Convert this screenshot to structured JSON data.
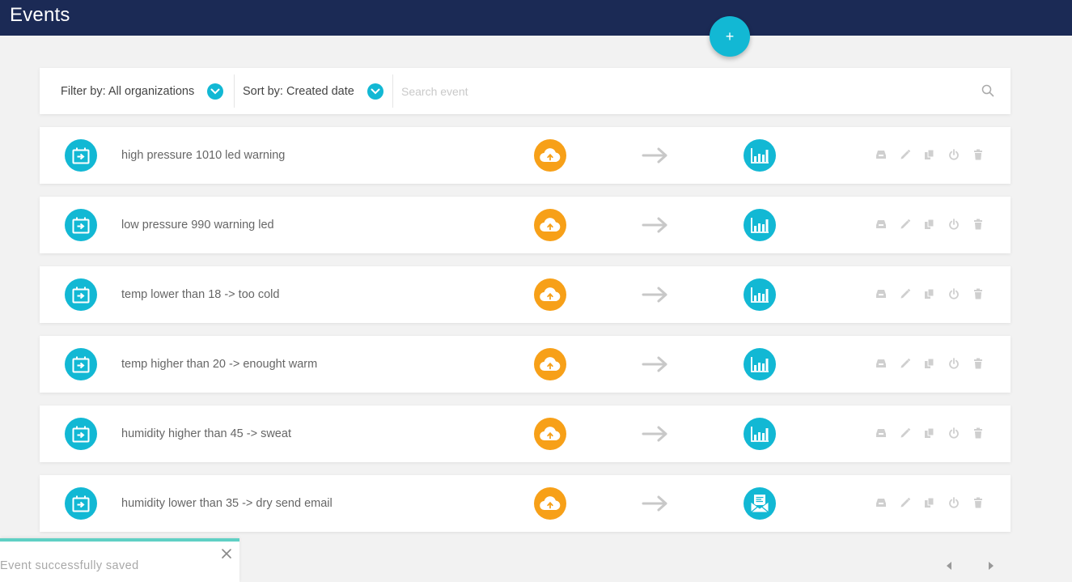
{
  "header": {
    "title": "Events"
  },
  "fab": {
    "label": "+"
  },
  "filters": {
    "filter_label": "Filter by: All organizations",
    "sort_label": "Sort by: Created date",
    "search_placeholder": "Search event"
  },
  "events": [
    {
      "name": "high pressure 1010 led warning",
      "trigger_icon": "cloud-upload-icon",
      "action_icon": "bar-chart-icon"
    },
    {
      "name": "low pressure 990 warning led",
      "trigger_icon": "cloud-upload-icon",
      "action_icon": "bar-chart-icon"
    },
    {
      "name": "temp lower than 18 -> too cold",
      "trigger_icon": "cloud-upload-icon",
      "action_icon": "bar-chart-icon"
    },
    {
      "name": "temp higher than 20 -> enought warm",
      "trigger_icon": "cloud-upload-icon",
      "action_icon": "bar-chart-icon"
    },
    {
      "name": "humidity higher than 45 -> sweat",
      "trigger_icon": "cloud-upload-icon",
      "action_icon": "bar-chart-icon"
    },
    {
      "name": "humidity lower than 35 -> dry send email",
      "trigger_icon": "cloud-upload-icon",
      "action_icon": "email-icon"
    }
  ],
  "row_actions": [
    "inbox-icon",
    "edit-icon",
    "copy-icon",
    "power-icon",
    "delete-icon"
  ],
  "toast": {
    "message": "Event successfully saved"
  },
  "colors": {
    "header": "#1b2a55",
    "accent": "#12b8d4",
    "trigger": "#f7a018",
    "toast_border": "#5fd0c4"
  }
}
